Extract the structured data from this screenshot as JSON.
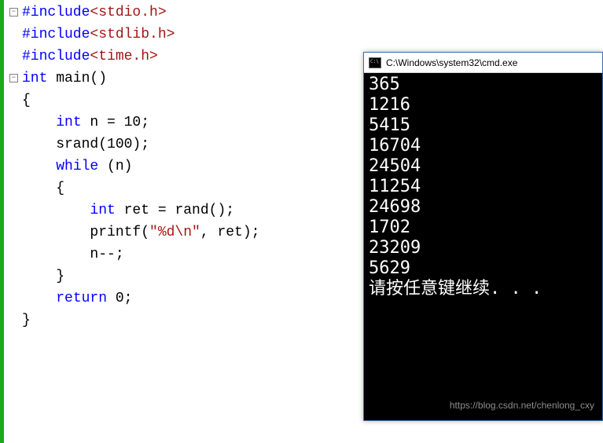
{
  "code": {
    "lines": [
      {
        "segments": [
          {
            "t": "#include",
            "c": "kw-blue"
          },
          {
            "t": "<stdio.h>",
            "c": "kw-maroon"
          }
        ],
        "fold": true
      },
      {
        "segments": [
          {
            "t": "#include",
            "c": "kw-blue"
          },
          {
            "t": "<stdlib.h>",
            "c": "kw-maroon"
          }
        ]
      },
      {
        "segments": [
          {
            "t": "#include",
            "c": "kw-blue"
          },
          {
            "t": "<time.h>",
            "c": "kw-maroon"
          }
        ]
      },
      {
        "segments": [
          {
            "t": "int",
            "c": "kw-blue"
          },
          {
            "t": " main()",
            "c": ""
          }
        ],
        "fold": true
      },
      {
        "segments": [
          {
            "t": "{",
            "c": ""
          }
        ]
      },
      {
        "segments": [
          {
            "t": "    ",
            "c": ""
          },
          {
            "t": "int",
            "c": "kw-blue"
          },
          {
            "t": " n = 10;",
            "c": ""
          }
        ]
      },
      {
        "segments": [
          {
            "t": "    srand(100);",
            "c": ""
          }
        ]
      },
      {
        "segments": [
          {
            "t": "    ",
            "c": ""
          },
          {
            "t": "while",
            "c": "kw-blue"
          },
          {
            "t": " (n)",
            "c": ""
          }
        ]
      },
      {
        "segments": [
          {
            "t": "    {",
            "c": ""
          }
        ]
      },
      {
        "segments": [
          {
            "t": "        ",
            "c": ""
          },
          {
            "t": "int",
            "c": "kw-blue"
          },
          {
            "t": " ret = rand();",
            "c": ""
          }
        ]
      },
      {
        "segments": [
          {
            "t": "        printf(",
            "c": ""
          },
          {
            "t": "\"%d\\n\"",
            "c": "str"
          },
          {
            "t": ", ret);",
            "c": ""
          }
        ]
      },
      {
        "segments": [
          {
            "t": "        n--;",
            "c": ""
          }
        ]
      },
      {
        "segments": [
          {
            "t": "    }",
            "c": ""
          }
        ]
      },
      {
        "segments": [
          {
            "t": "    ",
            "c": ""
          },
          {
            "t": "return",
            "c": "kw-blue"
          },
          {
            "t": " 0;",
            "c": ""
          }
        ]
      },
      {
        "segments": [
          {
            "t": "}",
            "c": ""
          }
        ]
      }
    ]
  },
  "cmd": {
    "title": "C:\\Windows\\system32\\cmd.exe",
    "output": [
      "365",
      "1216",
      "5415",
      "16704",
      "24504",
      "11254",
      "24698",
      "1702",
      "23209",
      "5629",
      "请按任意键继续. . ."
    ]
  },
  "watermark": "https://blog.csdn.net/chenlong_cxy"
}
